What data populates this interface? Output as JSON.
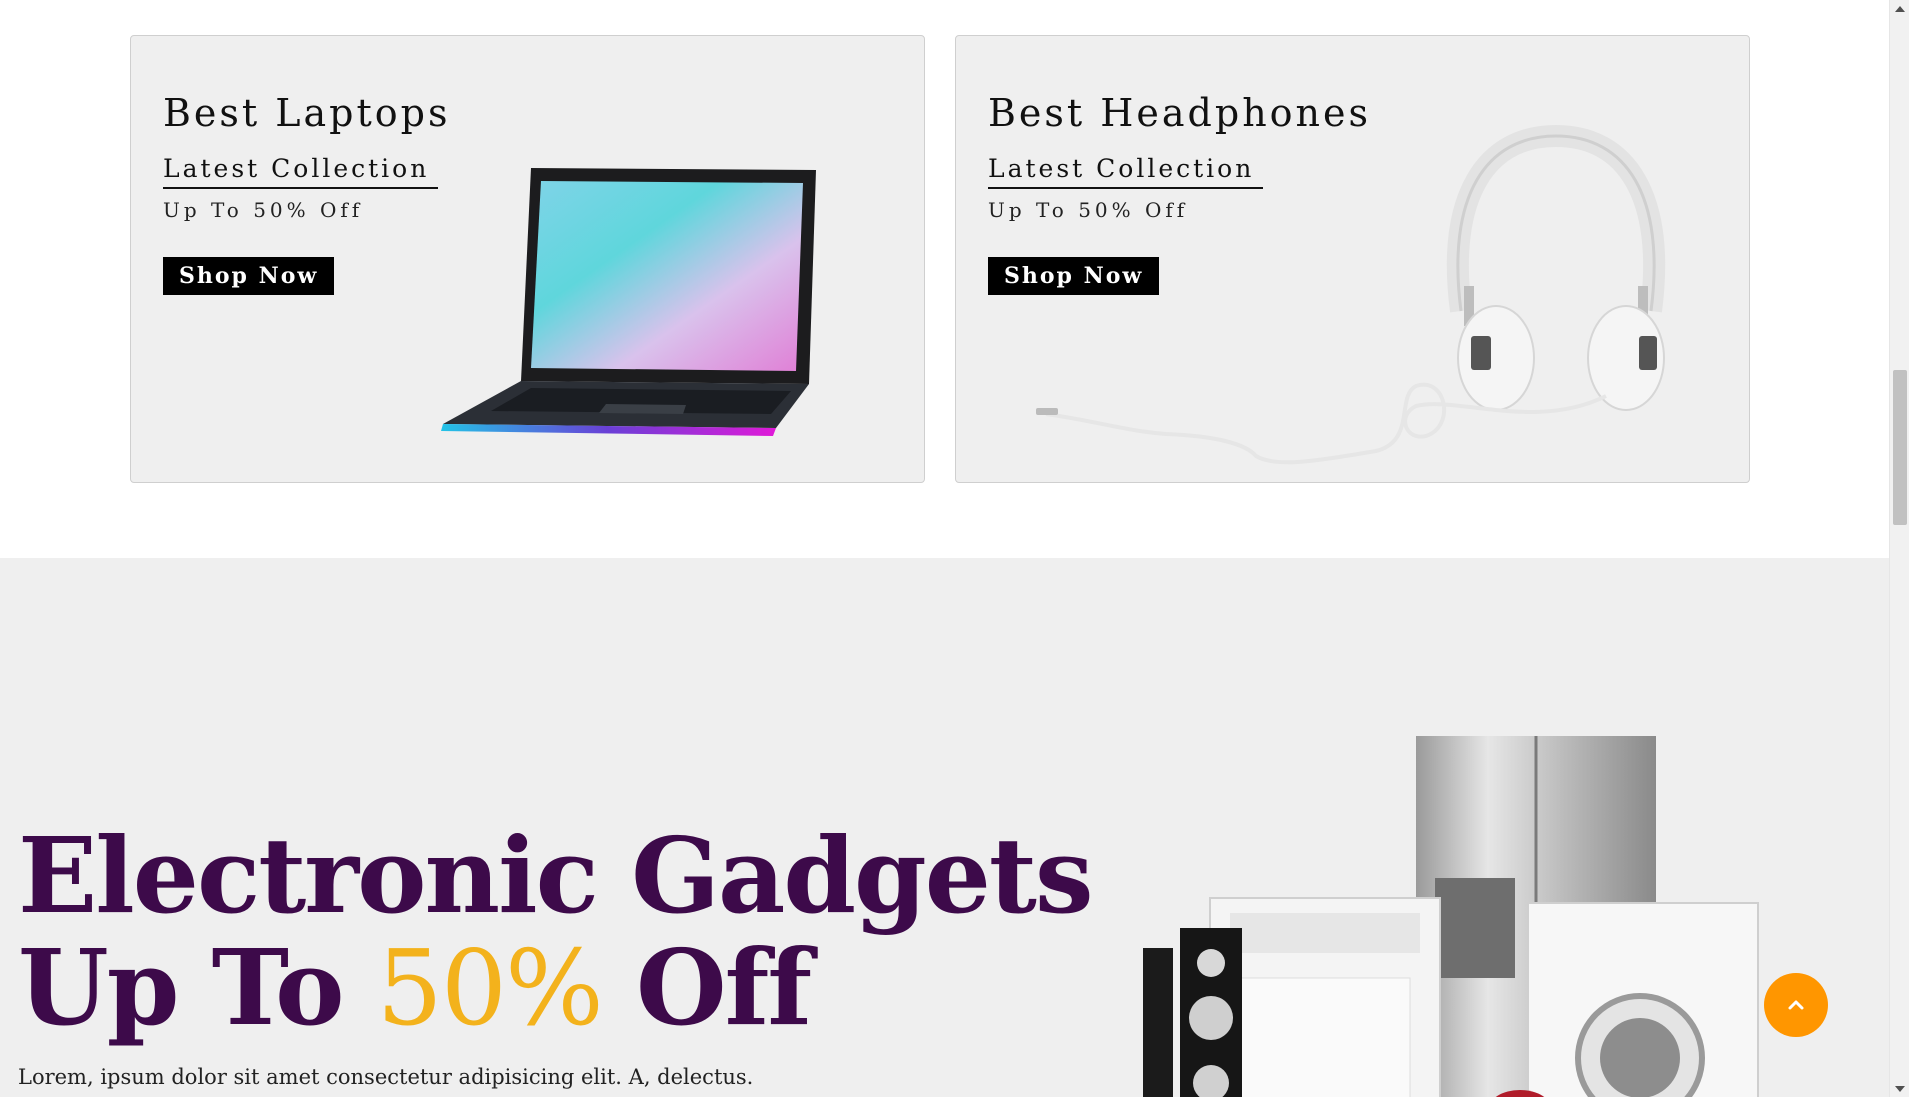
{
  "cards": [
    {
      "title": "Best Laptops",
      "subtitle": "Latest Collection",
      "offer": "Up To 50% Off",
      "button": "Shop Now",
      "image": "laptop-image"
    },
    {
      "title": "Best Headphones",
      "subtitle": "Latest Collection",
      "offer": "Up To 50% Off",
      "button": "Shop Now",
      "image": "headphones-image"
    }
  ],
  "hero": {
    "title_line1": "Electronic Gadgets",
    "title_line2_prefix": "Up To ",
    "title_line2_accent": "50%",
    "title_line2_suffix": " Off",
    "description": "Lorem, ipsum dolor sit amet consectetur adipisicing elit. A, delectus.",
    "image": "home-appliances-image"
  },
  "scroll_top_icon": "chevron-up-icon",
  "colors": {
    "hero_title": "#3d0a4a",
    "hero_accent": "#f3b21c",
    "scroll_top_button": "#ff9600",
    "card_bg": "#efefef",
    "button_bg": "#000000"
  }
}
